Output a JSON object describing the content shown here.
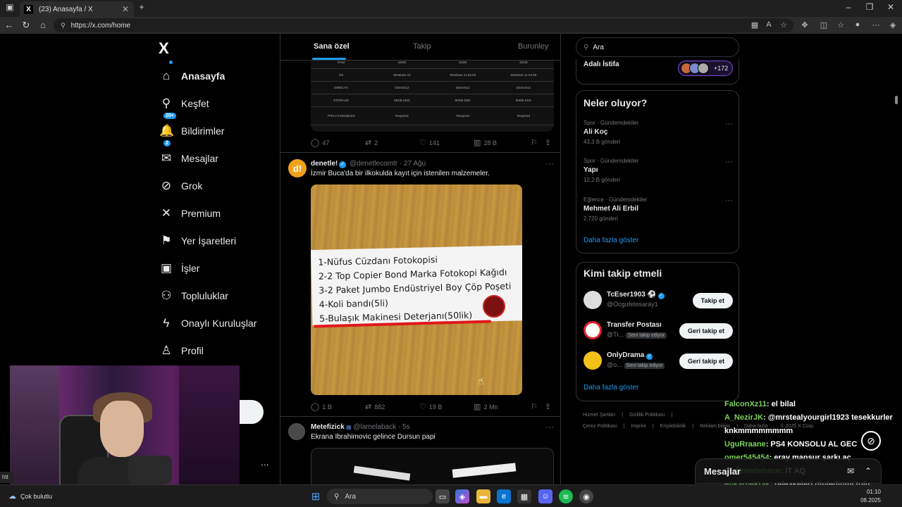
{
  "browser": {
    "tab_title": "(23) Anasayfa / X",
    "url": "https://x.com/home",
    "tab_close": "✕",
    "new_tab": "+"
  },
  "nav": {
    "logo": "X",
    "items": [
      {
        "label": "Anasayfa",
        "icon": "home-icon",
        "glyph": "⌂"
      },
      {
        "label": "Keşfet",
        "icon": "search-icon",
        "glyph": "⚲"
      },
      {
        "label": "Bildirimler",
        "icon": "bell-icon",
        "glyph": "🔔",
        "badge": "20+"
      },
      {
        "label": "Mesajlar",
        "icon": "mail-icon",
        "glyph": "✉",
        "badge": "2"
      },
      {
        "label": "Grok",
        "icon": "grok-icon",
        "glyph": "⊘"
      },
      {
        "label": "Premium",
        "icon": "x-premium-icon",
        "glyph": "✕"
      },
      {
        "label": "Yer İşaretleri",
        "icon": "bookmark-icon",
        "glyph": "⚑"
      },
      {
        "label": "İşler",
        "icon": "briefcase-icon",
        "glyph": "▣"
      },
      {
        "label": "Topluluklar",
        "icon": "communities-icon",
        "glyph": "⚇"
      },
      {
        "label": "Onaylı Kuruluşlar",
        "icon": "lightning-icon",
        "glyph": "ϟ"
      },
      {
        "label": "Profil",
        "icon": "profile-icon",
        "glyph": "♙"
      }
    ],
    "more": "..."
  },
  "feed": {
    "tabs": [
      "Sana özel",
      "Takip",
      "Burunley"
    ],
    "post1_actions": {
      "reply": "47",
      "repost": "2",
      "like": "141",
      "views": "28 B"
    },
    "post2": {
      "name": "denetle!",
      "handle": "@denetlecomtr",
      "time": "27 Ağu",
      "text": "İzmir Buca'da bir ilkokulda kayıt için istenilen malzemeler.",
      "image_lines": [
        "1-Nüfus Cüzdanı Fotokopisi",
        "2-2 Top Copier Bond Marka Fotokopi Kağıdı",
        "3-2 Paket Jumbo Endüstriyel  Boy Çöp Poşeti",
        "4-Koli bandı(5li)",
        "5-Bulaşık Makinesi Deterjanı(50lik)"
      ],
      "actions": {
        "reply": "1 B",
        "repost": "882",
        "like": "19 B",
        "views": "2 Mn"
      }
    },
    "post3": {
      "name": "Metefizick",
      "handle": "@lamelaback",
      "time": "5s",
      "text": "Ekrana Ibrahimovic gelince Dursun papi"
    }
  },
  "right": {
    "search_value": "Ara",
    "top_card": {
      "title": "Adalı İstifa",
      "count": "+172"
    },
    "trends_title": "Neler oluyor?",
    "trends": [
      {
        "category": "Spor · Gündemdekiler",
        "title": "Ali Koç",
        "count": "43,3 B gönderi"
      },
      {
        "category": "Spor · Gündemdekiler",
        "title": "Yapı",
        "count": "12,2 B gönderi"
      },
      {
        "category": "Eğlence · Gündemdekiler",
        "title": "Mehmet Ali Erbil",
        "count": "2.720 gönderi"
      }
    ],
    "show_more": "Daha fazla göster",
    "follow_title": "Kimi takip etmeli",
    "follow": [
      {
        "name": "TcEser1903",
        "handle": "@Ocgufetosaray1",
        "tag": "",
        "button": "Takip et"
      },
      {
        "name": "Transfer Postası",
        "handle": "@Tr...",
        "tag": "Seni takip ediyor",
        "button": "Geri takip et"
      },
      {
        "name": "OnlyDrama",
        "handle": "@o...",
        "tag": "Seni takip ediyor",
        "button": "Geri takip et"
      }
    ],
    "footer": [
      "Hizmet Şartları",
      "|",
      "Gizlilik Politikası",
      "|",
      "Çerez Politikası",
      "|",
      "Imprint",
      "|",
      "Erişilebilirlik",
      "|",
      "Reklam bilgisi",
      "|",
      "Daha fazla ···",
      "© 2025 X Corp."
    ]
  },
  "messages_bar": {
    "title": "Mesajlar"
  },
  "chat": [
    {
      "user": "FalconXz11",
      "msg": ": el bilal"
    },
    {
      "user": "A_NezirJK",
      "msg": ": @mrstealyourgirl1923 tesekkurler knkmmmmmmmm"
    },
    {
      "user": "UguRraane",
      "msg": ": PS4 KONSOLU AL GEC"
    },
    {
      "user": "omer545454",
      "msg": ": eray mansur şarkı aç"
    },
    {
      "user": "yildizmetehann",
      "msg": ": İT AQ"
    },
    {
      "user": "ensarpektas",
      "msg": ": releaseleri dinledinmi tolu"
    },
    {
      "user": "tensionxdd",
      "msg": ": abi oyun var mı oyun"
    }
  ],
  "taskbar": {
    "weather": "Çok bulutlu",
    "search": "Ara",
    "time": "01:10",
    "date": "08.2025"
  },
  "colors": {
    "accent": "#1d9bf0",
    "chat_user": "#7cd35a",
    "background": "#000000"
  }
}
